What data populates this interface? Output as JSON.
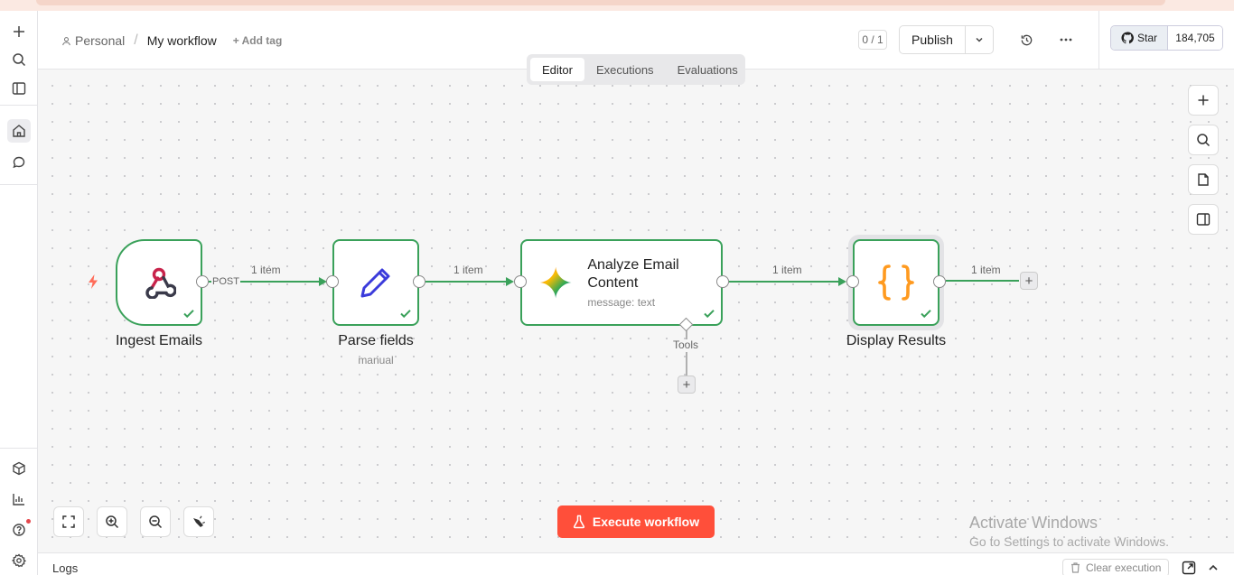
{
  "sidebar": {
    "icons": [
      "plus-icon",
      "search-icon",
      "panel-icon",
      "home-icon",
      "chat-icon",
      "cube-icon",
      "chart-icon",
      "help-icon",
      "settings-icon"
    ]
  },
  "header": {
    "breadcrumb_personal": "Personal",
    "breadcrumb_sep": "/",
    "workflow_name": "My workflow",
    "add_tag": "+ Add tag",
    "version_counter": "0 / 1",
    "publish_label": "Publish",
    "github_star_label": "Star",
    "github_star_count": "184,705"
  },
  "tabs": {
    "editor": "Editor",
    "executions": "Executions",
    "evaluations": "Evaluations",
    "active": "Editor"
  },
  "nodes": {
    "ingest": {
      "title": "Ingest Emails",
      "status": "success"
    },
    "parse": {
      "title": "Parse fields",
      "subtitle": "manual",
      "status": "success"
    },
    "analyze": {
      "title": "Analyze Email Content",
      "subtitle": "message: text",
      "status": "success"
    },
    "display": {
      "title": "Display Results",
      "status": "success"
    }
  },
  "edges": {
    "post_label": "POST",
    "e1_label": "1 item",
    "e2_label": "1 item",
    "e3_label": "1 item",
    "e4_label": "1 item",
    "tools_label": "Tools"
  },
  "colors": {
    "accent": "#ff4f3a",
    "success": "#3aa15a",
    "trigger_bolt": "#ff6d5a",
    "display_icon": "#ff9a1f",
    "parse_icon": "#3b3bdb",
    "webhook_red": "#c8234b"
  },
  "canvas_controls": {
    "execute_label": "Execute workflow"
  },
  "watermark": {
    "line1": "Activate Windows",
    "line2": "Go to Settings to activate Windows."
  },
  "logs": {
    "label": "Logs",
    "clear_execution": "Clear execution"
  }
}
